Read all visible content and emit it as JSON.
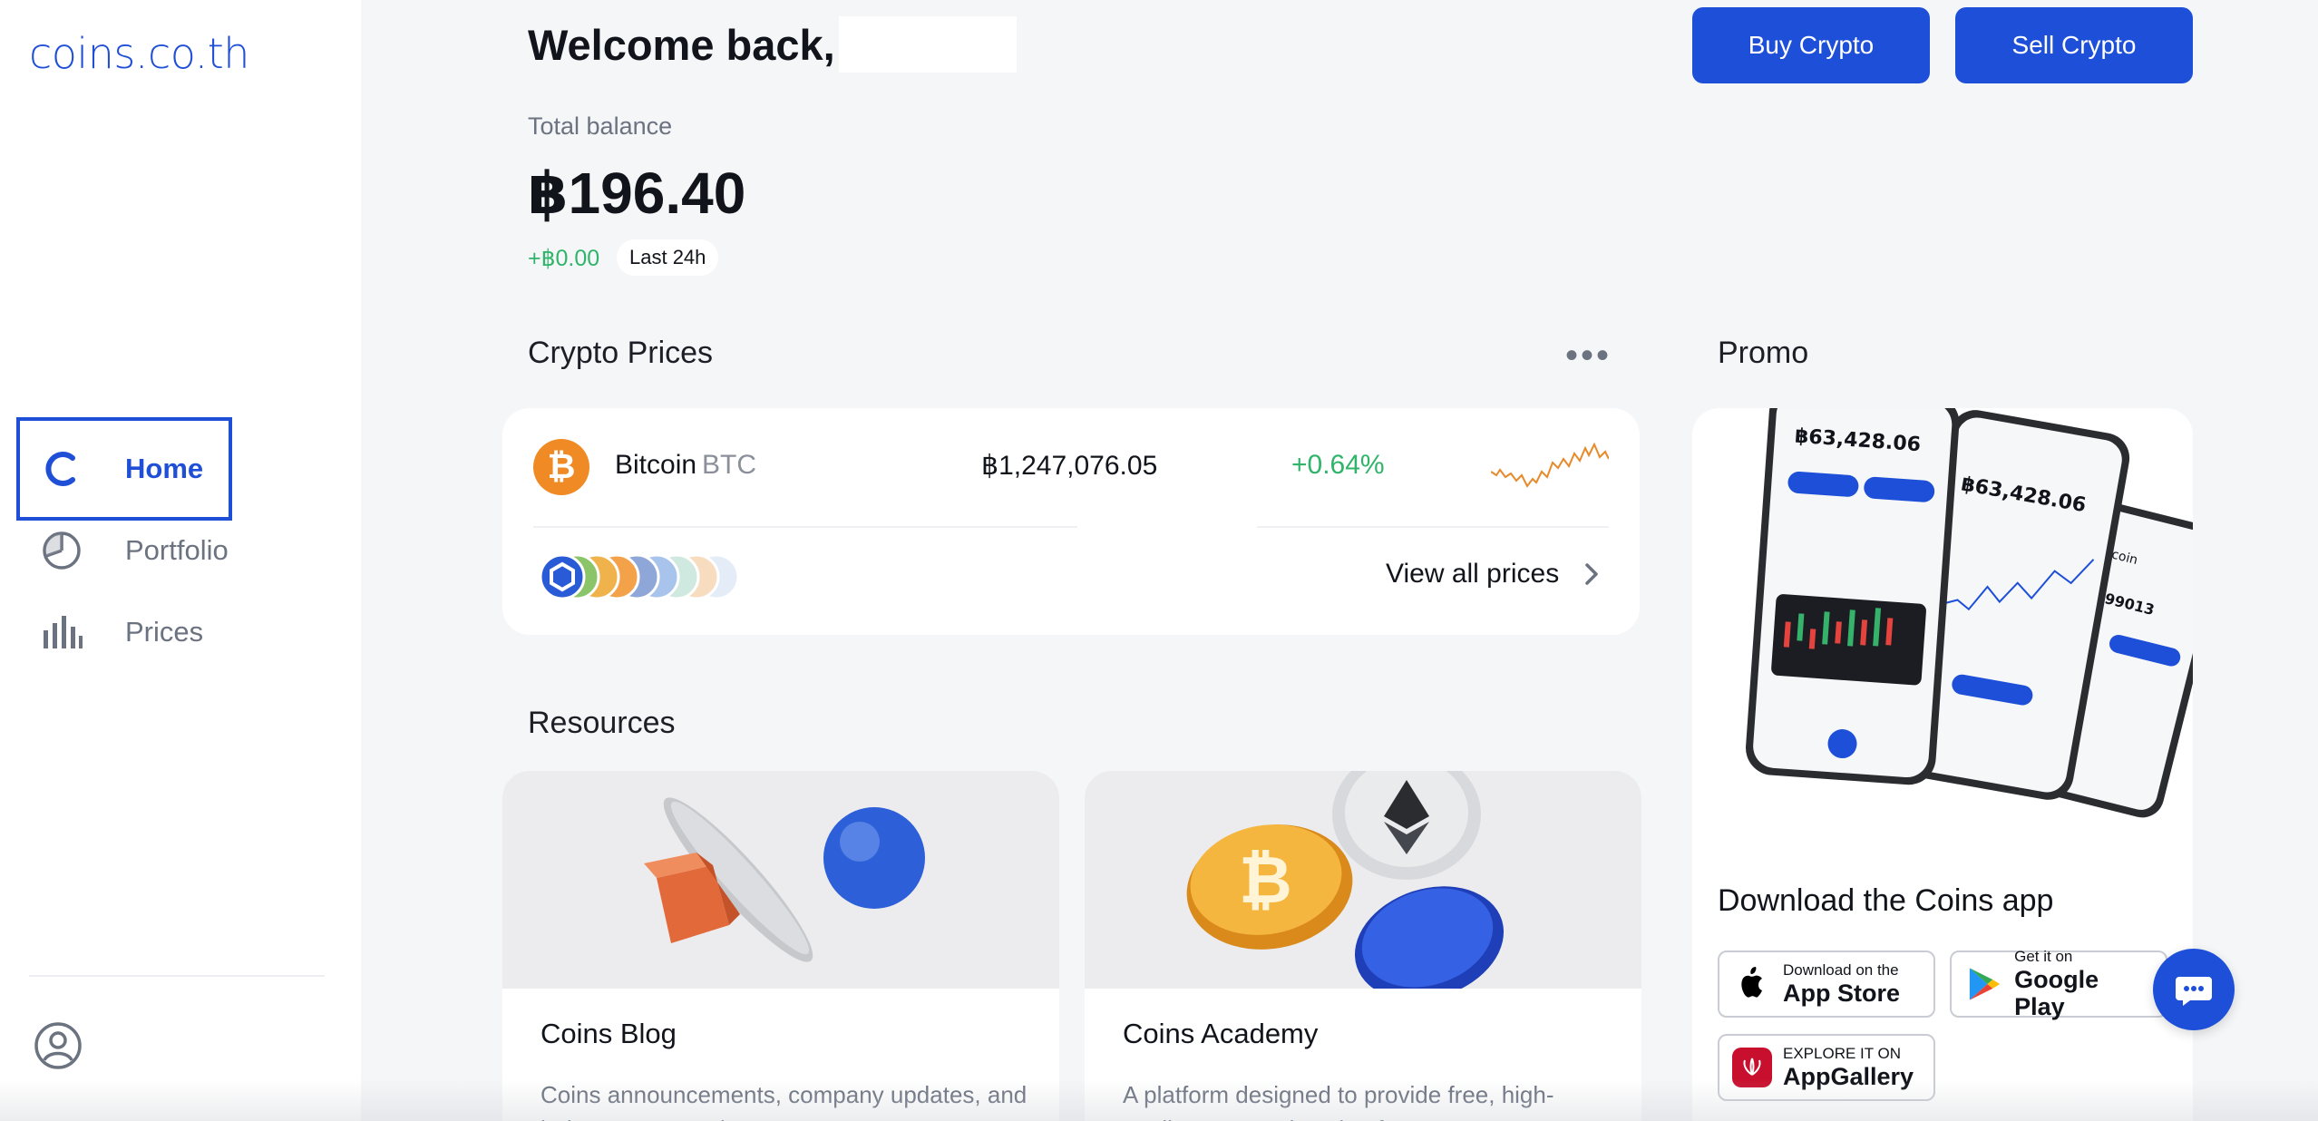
{
  "app": {
    "logo_text": "coins.co.th"
  },
  "sidebar": {
    "items": [
      {
        "label": "Home",
        "icon": "coins-c-icon",
        "active": true
      },
      {
        "label": "Portfolio",
        "icon": "pie-chart-icon",
        "active": false
      },
      {
        "label": "Prices",
        "icon": "bar-chart-icon",
        "active": false
      }
    ],
    "profile_icon": "user-circle-icon"
  },
  "header": {
    "welcome": "Welcome back,",
    "buy_label": "Buy Crypto",
    "sell_label": "Sell Crypto"
  },
  "balance": {
    "label": "Total balance",
    "value": "฿196.40",
    "change": "+฿0.00",
    "period": "Last 24h"
  },
  "crypto_prices": {
    "title": "Crypto Prices",
    "more_icon": "more-horizontal-icon",
    "rows": [
      {
        "name": "Bitcoin",
        "symbol": "BTC",
        "price": "฿1,247,076.05",
        "change": "+0.64%",
        "icon": "bitcoin-icon"
      }
    ],
    "view_all": "View all prices",
    "colors": {
      "positive": "#2fb46a",
      "bitcoin": "#f08a24",
      "sparkline": "#e8892a"
    }
  },
  "resources": {
    "title": "Resources",
    "cards": [
      {
        "title": "Coins Blog",
        "description": "Coins announcements, company updates, and industry perspectives"
      },
      {
        "title": "Coins Academy",
        "description": "A platform designed to provide free, high-quality crypto education for everyone"
      }
    ]
  },
  "promo": {
    "title": "Promo",
    "phone_balance_1": "฿63,428.06",
    "phone_balance_2": "฿63,428.06",
    "download_title": "Download the Coins app",
    "stores": [
      {
        "small": "Download on the",
        "big": "App Store",
        "icon": "apple-icon"
      },
      {
        "small": "Get it on",
        "big": "Google Play",
        "icon": "google-play-icon"
      },
      {
        "small": "EXPLORE IT ON",
        "big": "AppGallery",
        "icon": "huawei-icon"
      }
    ]
  },
  "chat": {
    "icon": "chat-bubble-icon"
  },
  "theme": {
    "accent": "#1e4fd8"
  }
}
